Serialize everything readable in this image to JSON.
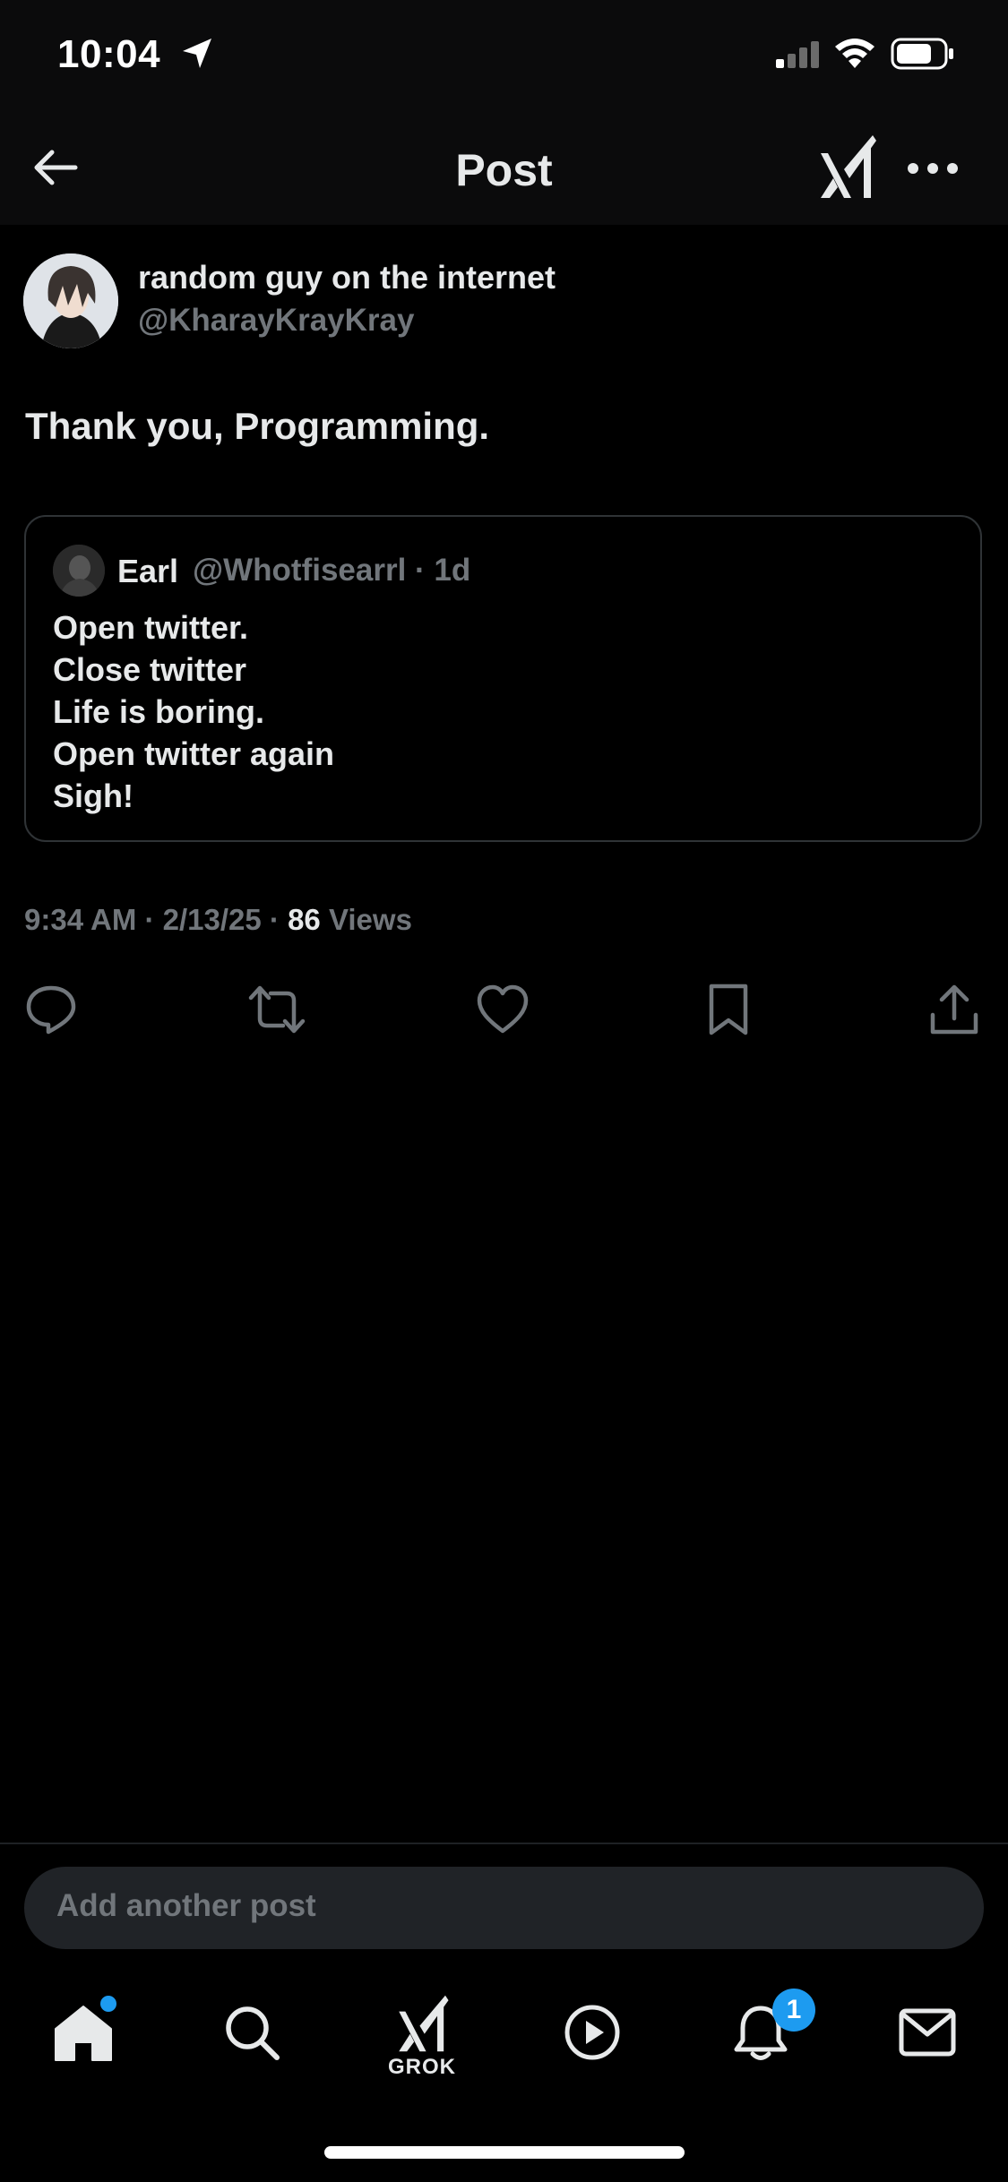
{
  "status_bar": {
    "time": "10:04"
  },
  "header": {
    "title": "Post"
  },
  "post": {
    "author_name": "random guy on the internet",
    "author_handle": "@KharayKrayKray",
    "text": "Thank you, Programming.",
    "timestamp": "9:34 AM · 2/13/25 · ",
    "views_count": "86",
    "views_label": " Views"
  },
  "quoted_post": {
    "author_name": "Earl",
    "meta": "@Whotfisearrl · 1d",
    "lines": [
      "Open twitter.",
      "Close twitter",
      "Life is boring.",
      "Open twitter again",
      "Sigh!"
    ]
  },
  "compose": {
    "placeholder": "Add another post"
  },
  "tabbar": {
    "grok_label": "GROK",
    "notifications_count": "1"
  },
  "colors": {
    "background": "#000000",
    "accent": "#1d9bf0",
    "secondary_text": "#71767b"
  }
}
